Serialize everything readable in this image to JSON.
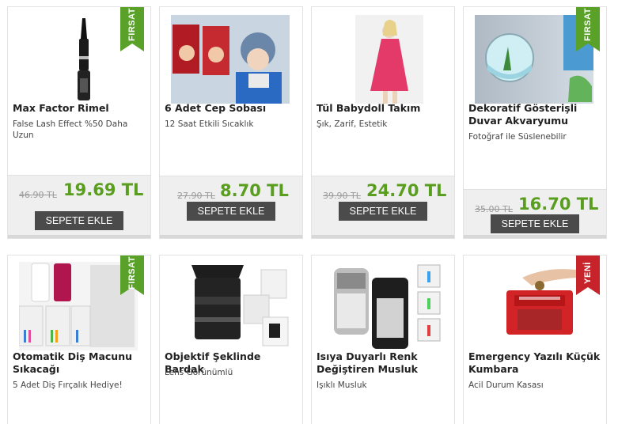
{
  "products": [
    {
      "title": "Max Factor Rimel",
      "subtitle": "False Lash Effect %50 Daha Uzun",
      "old_price": "46.90 TL",
      "new_price": "19.69 TL",
      "button": "SEPETE EKLE",
      "badge": "FIRSAT",
      "icon": "mascara-product-image"
    },
    {
      "title": "6 Adet Cep Sobası",
      "subtitle": "12 Saat Etkili Sıcaklık",
      "old_price": "27.90 TL",
      "new_price": "8.70 TL",
      "button": "SEPETE EKLE",
      "icon": "pocket-warmer-product-image"
    },
    {
      "title": "Tül Babydoll Takım",
      "subtitle": "Şık, Zarif, Estetik",
      "old_price": "39.90 TL",
      "new_price": "24.70 TL",
      "button": "SEPETE EKLE",
      "icon": "babydoll-product-image"
    },
    {
      "title": "Dekoratif Gösterişli Duvar Akvaryumu",
      "subtitle": "Fotoğraf ile Süslenebilir",
      "old_price": "35.00 TL",
      "new_price": "16.70 TL",
      "button": "SEPETE EKLE",
      "badge": "FIRSAT",
      "icon": "wall-aquarium-product-image"
    },
    {
      "title": "Otomatik Diş Macunu Sıkacağı",
      "subtitle": "5 Adet Diş Fırçalık Hediye!",
      "badge": "FIRSAT",
      "icon": "toothpaste-dispenser-product-image"
    },
    {
      "title": "Objektif Şeklinde Bardak",
      "subtitle": "Lens Görünümlü",
      "icon": "lens-mug-product-image"
    },
    {
      "title": "Isıya Duyarlı Renk Değiştiren Musluk",
      "subtitle": "Işıklı Musluk",
      "icon": "led-faucet-product-image"
    },
    {
      "title": "Emergency Yazılı Küçük Kumbara",
      "subtitle": "Acil Durum Kasası",
      "badge": "YENİ",
      "icon": "emergency-piggy-bank-product-image"
    }
  ],
  "colors": {
    "price_green": "#5a9e1f",
    "badge_green": "#5aa12a",
    "badge_red": "#c6242a",
    "button_dark": "#4b4b4b"
  }
}
